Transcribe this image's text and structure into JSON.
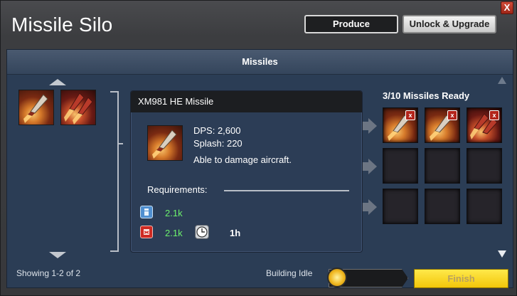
{
  "window": {
    "title": "Missile Silo",
    "close_label": "X"
  },
  "tabs": {
    "produce_label": "Produce",
    "unlock_label": "Unlock & Upgrade"
  },
  "panel": {
    "header": "Missiles"
  },
  "detail": {
    "name": "XM981 HE Missile",
    "dps": "DPS: 2,600",
    "splash": "Splash: 220",
    "description": "Able to damage aircraft.",
    "requirements_label": "Requirements:",
    "req_oil": "2.1k",
    "req_fuel": "2.1k",
    "req_time": "1h"
  },
  "ready": {
    "title": "3/10 Missiles Ready",
    "remove_label": "x"
  },
  "footer": {
    "showing": "Showing 1-2 of 2",
    "status": "Building Idle",
    "finish_label": "Finish"
  },
  "colors": {
    "accent_green": "#6cf06c",
    "finish_yellow": "#f5d214",
    "panel_blue": "#2b3d55"
  },
  "icons": {
    "oil": "oil-barrel-icon",
    "fuel": "fuel-can-icon",
    "time": "clock-icon"
  }
}
